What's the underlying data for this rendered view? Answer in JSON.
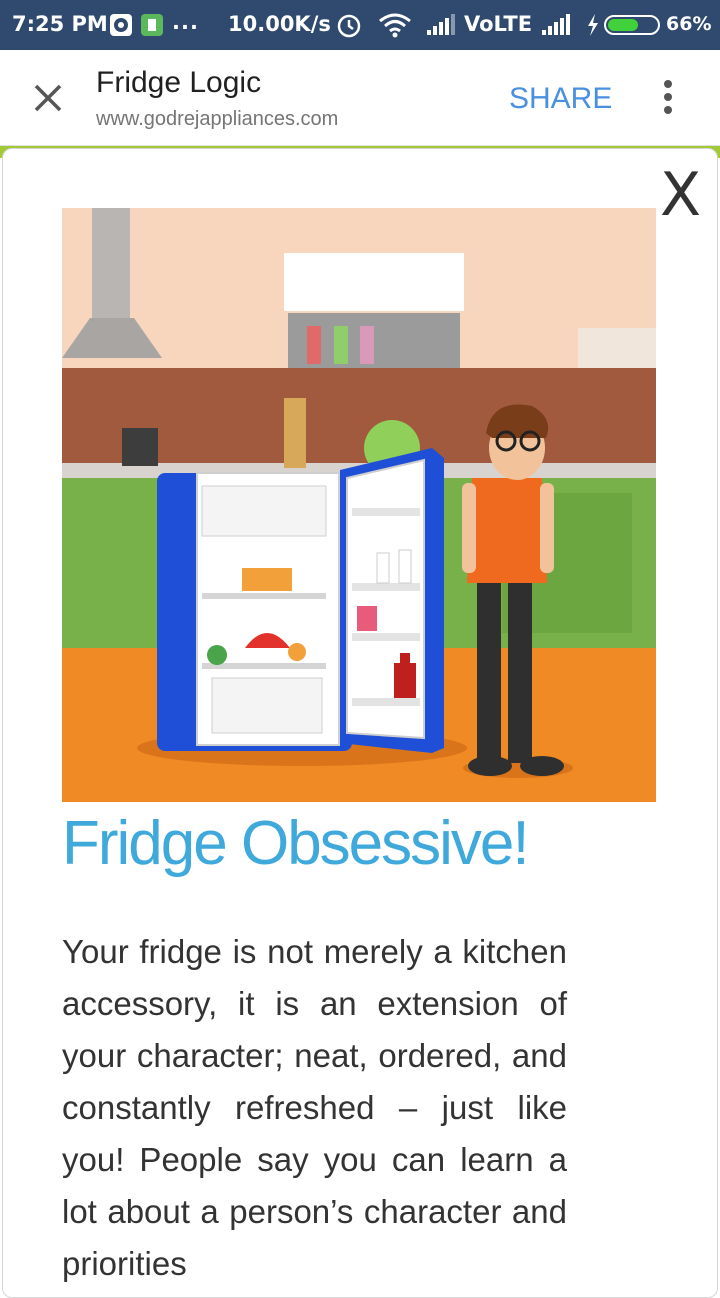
{
  "status_bar": {
    "time": "7:25 PM",
    "dots": "...",
    "speed": "10.00K/s",
    "network": "VoLTE",
    "battery": "66%",
    "icons": [
      "whatsapp-icon",
      "sim-icon",
      "alarm-icon",
      "wifi-icon",
      "signal-icon",
      "charging-icon",
      "battery-icon"
    ]
  },
  "app_bar": {
    "title": "Fridge Logic",
    "url": "www.godrejappliances.com",
    "share_label": "SHARE"
  },
  "card": {
    "close_label": "X",
    "heading": "Fridge Obsessive!",
    "body": "Your fridge is not merely a kitchen accessory, it is an extension of your character; neat, ordered, and constantly refreshed – just like you! People say you can learn a lot about a person’s character and priorities"
  },
  "colors": {
    "status_bar_bg": "#2f4a6e",
    "accent_share": "#4a90e2",
    "heading": "#3fa9dc",
    "strip": "#a4c936"
  }
}
